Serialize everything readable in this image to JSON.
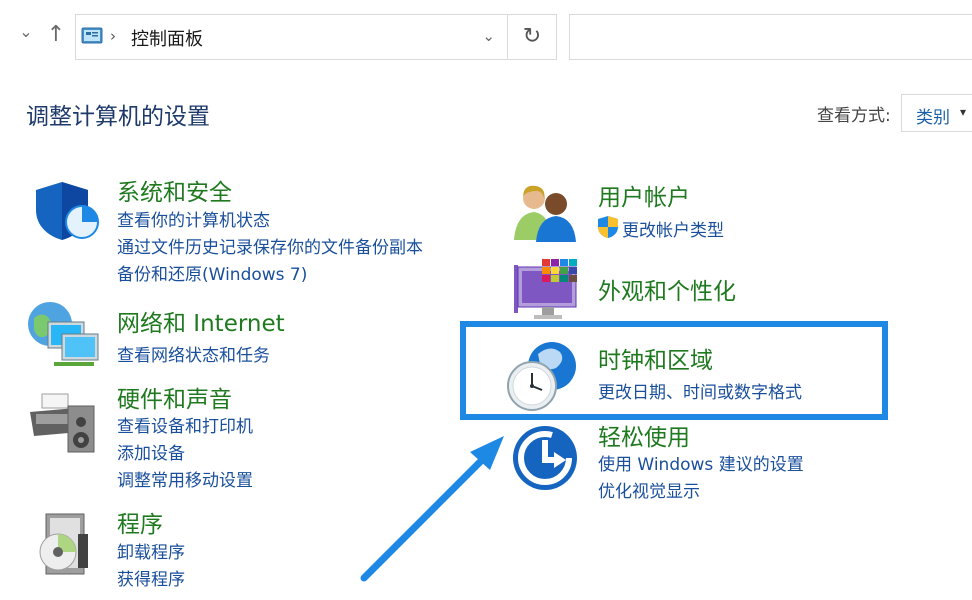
{
  "address_bar": {
    "breadcrumb": "控制面板",
    "separator": "›"
  },
  "nav": {
    "back_dropdown": "⌄",
    "up": "↑",
    "refresh": "↻",
    "address_dropdown": "⌄"
  },
  "page": {
    "title": "调整计算机的设置"
  },
  "view_by": {
    "label": "查看方式:",
    "value": "类别",
    "chevron": "▾"
  },
  "categories": [
    {
      "id": "security",
      "icon": "shield-icon",
      "title": "系统和安全",
      "links": [
        "查看你的计算机状态",
        "通过文件历史记录保存你的文件备份副本",
        "备份和还原(Windows 7)"
      ]
    },
    {
      "id": "network",
      "icon": "network-globe-icon",
      "title": "网络和 Internet",
      "links": [
        "查看网络状态和任务"
      ]
    },
    {
      "id": "hardware",
      "icon": "printer-speaker-icon",
      "title": "硬件和声音",
      "links": [
        "查看设备和打印机",
        "添加设备",
        "调整常用移动设置"
      ]
    },
    {
      "id": "programs",
      "icon": "programs-disc-icon",
      "title": "程序",
      "links": [
        "卸载程序",
        "获得程序"
      ]
    },
    {
      "id": "accounts",
      "icon": "users-icon",
      "title": "用户帐户",
      "links": [
        "更改帐户类型"
      ]
    },
    {
      "id": "appearance",
      "icon": "monitor-palette-icon",
      "title": "外观和个性化",
      "links": []
    },
    {
      "id": "clock",
      "icon": "clock-globe-icon",
      "title": "时钟和区域",
      "links": [
        "更改日期、时间或数字格式"
      ]
    },
    {
      "id": "ease",
      "icon": "ease-of-access-icon",
      "title": "轻松使用",
      "links": [
        "使用 Windows 建议的设置",
        "优化视觉显示"
      ]
    }
  ],
  "colors": {
    "heading": "#1f7a1f",
    "link": "#1a4f9c",
    "title": "#1e3a6b",
    "highlight": "#1e88e5"
  }
}
